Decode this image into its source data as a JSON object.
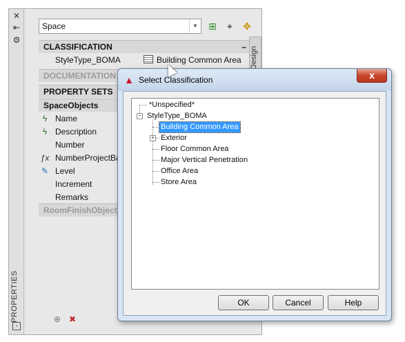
{
  "palette": {
    "title": "PROPERTIES",
    "side_tab": "Design",
    "style_select": {
      "value": "Space"
    },
    "sections": {
      "classification": "CLASSIFICATION",
      "documentation": "DOCUMENTATION",
      "property_sets": "PROPERTY SETS",
      "space_objects": "SpaceObjects",
      "room_finish_objects": "RoomFinishObjects"
    },
    "classification_row": {
      "label": "StyleType_BOMA",
      "value": "Building Common Area"
    },
    "properties": [
      {
        "label": "Name"
      },
      {
        "label": "Description"
      },
      {
        "label": "Number"
      },
      {
        "label": "NumberProjectBa"
      },
      {
        "label": "Level"
      },
      {
        "label": "Increment"
      },
      {
        "label": "Remarks"
      }
    ]
  },
  "dialog": {
    "title": "Select Classification",
    "close_label": "x",
    "tree": {
      "unspecified": "*Unspecified*",
      "root": "StyleType_BOMA",
      "children": [
        "Building Common Area",
        "Exterior",
        "Floor Common Area",
        "Major Vertical Penetration",
        "Office Area",
        "Store Area"
      ],
      "selected": "Building Common Area"
    },
    "buttons": {
      "ok": "OK",
      "cancel": "Cancel",
      "help": "Help"
    }
  }
}
